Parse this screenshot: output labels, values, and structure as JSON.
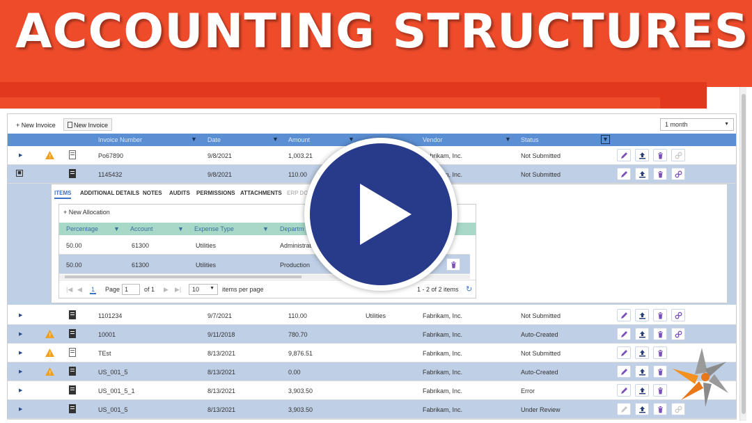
{
  "banner": {
    "title": "ACCOUNTING STRUCTURES"
  },
  "toolbar": {
    "new_invoice_1": "+ New Invoice",
    "new_invoice_2": "New Invoice",
    "period": "1 month"
  },
  "columns": {
    "invoice_number": "Invoice Number",
    "date": "Date",
    "amount": "Amount",
    "vendor": "Vendor",
    "status": "Status"
  },
  "rows": [
    {
      "number": "Po67890",
      "date": "9/8/2021",
      "amount": "1,003.21",
      "category": "",
      "vendor": "Fabrikam, Inc.",
      "status": "Not Submitted",
      "warn": true
    },
    {
      "number": "1145432",
      "date": "9/8/2021",
      "amount": "110.00",
      "category": "",
      "vendor": "Fabrikam, Inc.",
      "status": "Not Submitted",
      "warn": false
    },
    {
      "number": "1101234",
      "date": "9/7/2021",
      "amount": "110.00",
      "category": "Utilities",
      "vendor": "Fabrikam, Inc.",
      "status": "Not Submitted",
      "warn": false
    },
    {
      "number": "10001",
      "date": "9/11/2018",
      "amount": "780.70",
      "category": "",
      "vendor": "Fabrikam, Inc.",
      "status": "Auto-Created",
      "warn": true
    },
    {
      "number": "TEst",
      "date": "8/13/2021",
      "amount": "9,876.51",
      "category": "",
      "vendor": "Fabrikam, Inc.",
      "status": "Not Submitted",
      "warn": true
    },
    {
      "number": "US_001_5",
      "date": "8/13/2021",
      "amount": "0.00",
      "category": "",
      "vendor": "Fabrikam, Inc.",
      "status": "Auto-Created",
      "warn": true
    },
    {
      "number": "US_001_5_1",
      "date": "8/13/2021",
      "amount": "3,903.50",
      "category": "",
      "vendor": "Fabrikam, Inc.",
      "status": "Error",
      "warn": false
    },
    {
      "number": "US_001_5",
      "date": "8/13/2021",
      "amount": "3,903.50",
      "category": "",
      "vendor": "Fabrikam, Inc.",
      "status": "Under Review",
      "warn": false
    }
  ],
  "detail": {
    "tabs": [
      "ITEMS",
      "ADDITIONAL DETAILS",
      "NOTES",
      "AUDITS",
      "PERMISSIONS",
      "ATTACHMENTS",
      "ERP DO"
    ],
    "new_allocation": "+ New Allocation",
    "columns": {
      "percentage": "Percentage",
      "account": "Account",
      "expense_type": "Expense Type",
      "department": "Departm"
    },
    "rows": [
      {
        "percentage": "50.00",
        "account": "61300",
        "expense_type": "Utilities",
        "department": "Administrati"
      },
      {
        "percentage": "50.00",
        "account": "61300",
        "expense_type": "Utilities",
        "department": "Production"
      }
    ],
    "pager": {
      "current": "1",
      "page_label": "Page",
      "page_value": "1",
      "of": "of 1",
      "per_page": "10",
      "per_page_label": "items per page",
      "range": "1 - 2 of 2 items"
    }
  },
  "colors": {
    "banner": "#ee4b2b",
    "header": "#5b8fd4",
    "alt_row": "#bfcfe6",
    "play": "#283b8a",
    "subgrid_header": "#a8d8c8"
  }
}
